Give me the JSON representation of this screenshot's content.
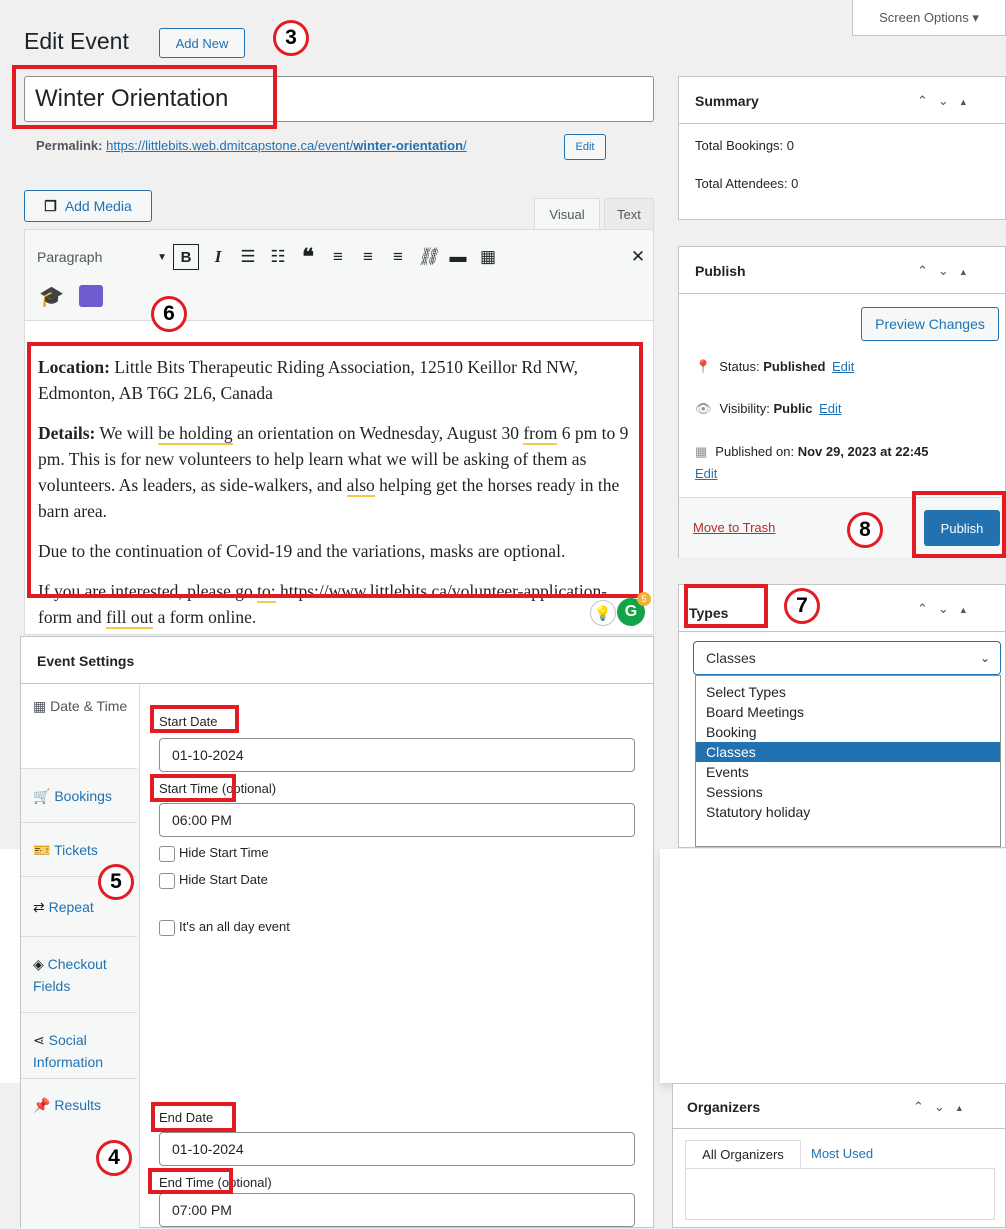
{
  "header": {
    "title": "Edit Event",
    "add_new": "Add New",
    "screen_options": "Screen Options ▾"
  },
  "post": {
    "title": "Winter Orientation",
    "permalink_label": "Permalink:",
    "permalink_base": "https://littlebits.web.dmitcapstone.ca/event/",
    "permalink_slug": "winter-orientation",
    "permalink_trail": "/",
    "permalink_edit": "Edit"
  },
  "editor": {
    "add_media": "Add Media",
    "tab_visual": "Visual",
    "tab_text": "Text",
    "format_select": "Paragraph",
    "content": {
      "p1_label": "Location:",
      "p1_text": " Little Bits Therapeutic Riding Association, 12510 Keillor Rd NW, Edmonton, AB T6G 2L6, Canada",
      "p2_label": "Details:",
      "p2_a": " We will ",
      "p2_u1": "be holding",
      "p2_b": " an orientation on Wednesday, August 30 ",
      "p2_u2": "from",
      "p2_c": " 6 pm to 9 pm. This is for new volunteers to help learn what we will be asking of them as volunteers. As leaders, as side-walkers, and ",
      "p2_u3": "also",
      "p2_d": " helping get the horses ready in the barn area.",
      "p3": "Due to the continuation of Covid-19 and the variations, masks are optional.",
      "p4_a": "If you are interested, please go ",
      "p4_u1": "to:",
      "p4_b": " https://www.littlebits.ca/volunteer-application-form and ",
      "p4_u2": "fill out",
      "p4_c": " a form online."
    },
    "grammarly_count": "5"
  },
  "event_settings": {
    "title": "Event Settings",
    "tabs": [
      "Date & Time",
      "Bookings",
      "Tickets",
      "Repeat",
      "Checkout Fields",
      "Social Information",
      "Results"
    ],
    "start_date_label": "Start Date",
    "start_date": "01-10-2024",
    "start_time_label": "Start Time",
    "start_time_suffix": " (optional)",
    "start_time": "06:00 PM",
    "hide_start_time": "Hide Start Time",
    "hide_start_date": "Hide Start Date",
    "all_day": "It's an all day event",
    "end_date_label": "End Date",
    "end_date": "01-10-2024",
    "end_time_label": "End Time",
    "end_time_suffix": " (optional)",
    "end_time": "07:00 PM"
  },
  "summary": {
    "title": "Summary",
    "bookings": "Total Bookings: 0",
    "attendees": "Total Attendees: 0"
  },
  "publish": {
    "title": "Publish",
    "preview": "Preview Changes",
    "status_label": "Status: ",
    "status_value": "Published",
    "visibility_label": "Visibility: ",
    "visibility_value": "Public",
    "published_label": "Published on: ",
    "published_value": "Nov 29, 2023 at 22:45",
    "edit": "Edit",
    "trash": "Move to Trash",
    "publish_btn": "Publish"
  },
  "types": {
    "title": "Types",
    "selected": "Classes",
    "options": [
      "Select Types",
      "Board Meetings",
      "Booking",
      "Classes",
      "Events",
      "Sessions",
      "Statutory holiday"
    ]
  },
  "organizers": {
    "title": "Organizers",
    "tab_all": "All Organizers",
    "tab_used": "Most Used"
  },
  "annotations": [
    "3",
    "4",
    "5",
    "6",
    "7",
    "8"
  ],
  "colors": {
    "accent": "#2271b1",
    "highlight": "#e31b23",
    "selected": "#2271b1"
  }
}
